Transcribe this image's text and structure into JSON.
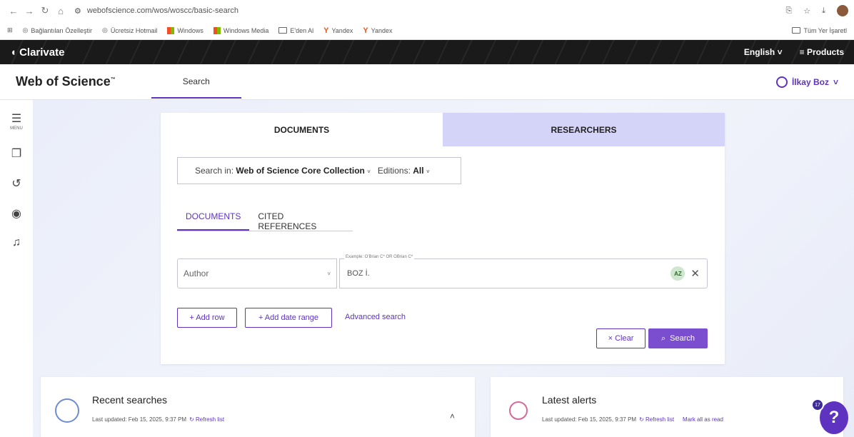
{
  "browser": {
    "url": "webofscience.com/wos/woscc/basic-search",
    "bookmarks": [
      "Bağlantıları Özelleştir",
      "Ücretsiz Hotmail",
      "Windows",
      "Windows Media",
      "E'den Al",
      "Yandex",
      "Yandex"
    ],
    "all_bookmarks": "Tüm Yer İşaretl"
  },
  "clarivate": {
    "logo": "Clarivate",
    "language": "English",
    "products": "Products"
  },
  "header": {
    "title": "Web of Science",
    "tm": "™",
    "search_tab": "Search",
    "user": "İlkay Boz"
  },
  "rail": {
    "menu_label": "MENU"
  },
  "main": {
    "tabs": [
      "DOCUMENTS",
      "RESEARCHERS"
    ],
    "search_in_label": "Search in:",
    "search_in_value": "Web of Science Core Collection",
    "editions_label": "Editions:",
    "editions_value": "All",
    "sub_tabs": [
      "DOCUMENTS",
      "CITED REFERENCES"
    ],
    "field_type": "Author",
    "field_hint": "Example: O'Brian C* OR OBrian C*",
    "field_value": "BOZ İ.",
    "az": "AZ",
    "add_row": "+ Add row",
    "add_date_range": "+ Add date range",
    "advanced_search": "Advanced search",
    "clear": "× Clear",
    "search": "Search"
  },
  "recent": {
    "title": "Recent searches",
    "updated": "Last updated: Feb 15, 2025, 9:37 PM",
    "refresh": "Refresh list"
  },
  "alerts": {
    "title": "Latest alerts",
    "updated": "Last updated: Feb 15, 2025, 9:37 PM",
    "refresh": "Refresh list",
    "mark_all": "Mark all as read"
  },
  "help": {
    "badge": "17",
    "symbol": "?"
  }
}
